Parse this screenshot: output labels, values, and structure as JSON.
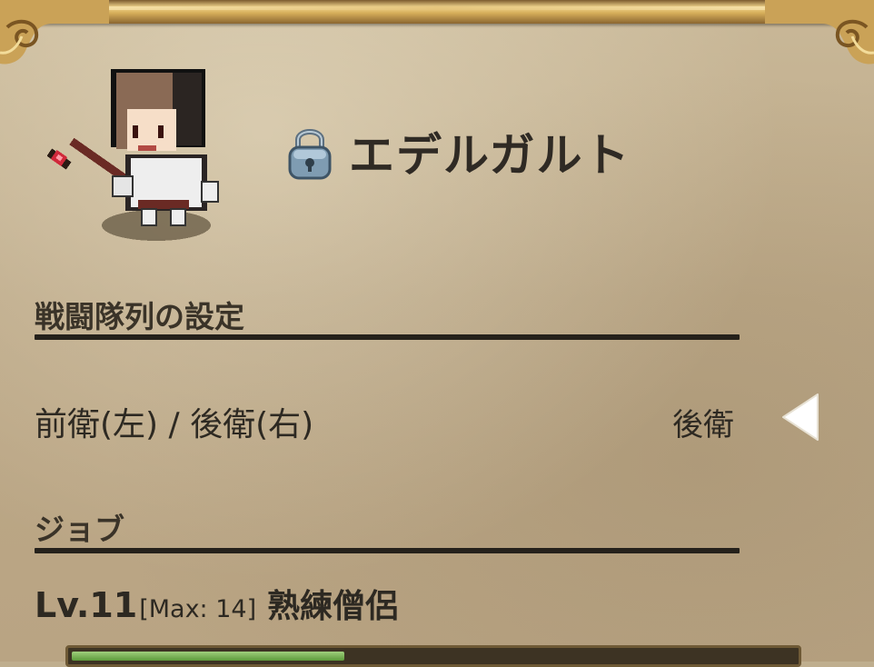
{
  "character": {
    "name": "エデルガルト",
    "locked": true
  },
  "formation": {
    "section_title": "戦闘隊列の設定",
    "setting_label": "前衛(左) / 後衛(右)",
    "setting_value": "後衛"
  },
  "job": {
    "section_title": "ジョブ",
    "level": "Lv.11",
    "max": "[Max: 14]",
    "name": "熟練僧侶"
  },
  "colors": {
    "parchment": "#bfae8e",
    "text": "#2d2922",
    "gold_frame": "#d6ae5a",
    "rule": "#25211b"
  },
  "icons": {
    "lock": "padlock-icon",
    "arrow": "triangle-left-icon"
  }
}
